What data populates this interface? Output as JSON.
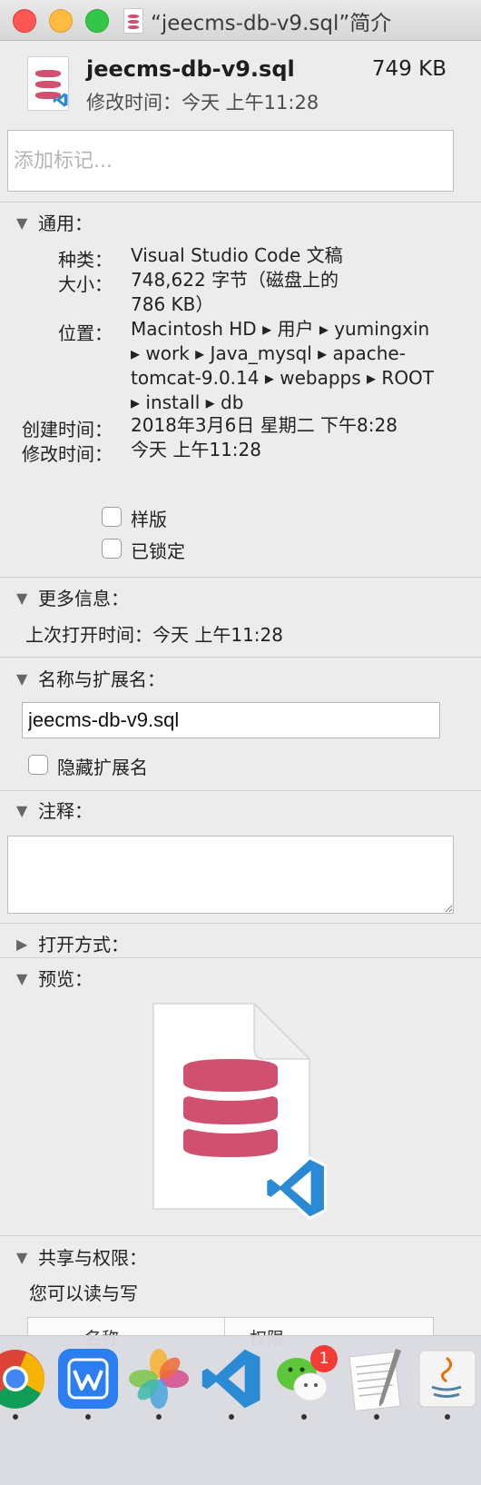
{
  "window": {
    "title": "“jeecms-db-v9.sql”简介"
  },
  "header": {
    "file_name": "jeecms-db-v9.sql",
    "file_size": "749 KB",
    "modified": "修改时间：今天 上午11:28"
  },
  "tags": {
    "placeholder": "添加标记..."
  },
  "general": {
    "title": "通用：",
    "kind_label": "种类：",
    "kind_value": "Visual Studio Code 文稿",
    "size_label": "大小：",
    "size_value_1": "748,622 字节（磁盘上的",
    "size_value_2": "786 KB）",
    "where_label": "位置：",
    "where_1": "Macintosh HD ▸ 用户 ▸ yumingxin",
    "where_2": "▸ work ▸ Java_mysql ▸ apache-",
    "where_3": "tomcat-9.0.14 ▸ webapps ▸ ROOT",
    "where_4": "▸ install ▸ db",
    "created_label": "创建时间：",
    "created_value": "2018年3月6日 星期二 下午8:28",
    "modified_label": "修改时间：",
    "modified_value": "今天 上午11:28",
    "stationery_label": "样版",
    "locked_label": "已锁定"
  },
  "more_info": {
    "title": "更多信息：",
    "last_opened": "上次打开时间：今天 上午11:28"
  },
  "name_ext": {
    "title": "名称与扩展名：",
    "name_value": "jeecms-db-v9.sql",
    "hide_ext_label": "隐藏扩展名"
  },
  "comments": {
    "title": "注释："
  },
  "open_with": {
    "title": "打开方式："
  },
  "preview": {
    "title": "预览："
  },
  "sharing": {
    "title": "共享与权限：",
    "status": "您可以读与写",
    "col_name": "名称",
    "col_priv": "权限"
  },
  "dock": {
    "apps": [
      "chrome-icon",
      "wps-icon",
      "photos-icon",
      "vscode-icon",
      "wechat-icon",
      "textedit-icon",
      "java-icon"
    ],
    "wechat_badge": "1"
  },
  "colors": {
    "db_pink": "#d0506f",
    "vscode_blue": "#2a8ad4"
  }
}
